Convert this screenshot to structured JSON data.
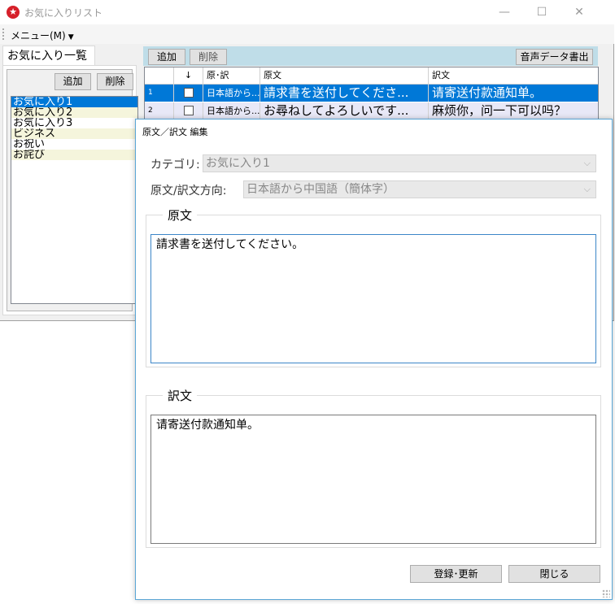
{
  "main_window": {
    "title": "お気に入りリスト",
    "icon": "favorite-star-icon",
    "controls": {
      "minimize": "—",
      "maximize": "☐",
      "close": "✕"
    }
  },
  "menubar": {
    "menu_label": "メニュー(M)"
  },
  "favorites_panel": {
    "tab_label": "お気に入り一覧",
    "add_button": "追加",
    "delete_button": "削除",
    "categories": [
      "お気に入り1",
      "お気に入り2",
      "お気に入り3",
      "ビジネス",
      "お祝い",
      "お詫び"
    ],
    "selected_index": 0
  },
  "phrase_toolbar": {
    "add_button": "追加",
    "delete_button": "削除",
    "export_audio_button": "音声データ書出"
  },
  "phrase_grid": {
    "headers": {
      "no": "",
      "check": "↓",
      "direction": "原･訳",
      "source": "原文",
      "translation": "訳文"
    },
    "rows": [
      {
        "no": "1",
        "direction": "日本語から...",
        "source": "請求書を送付してくださ...",
        "translation": "请寄送付款通知单。"
      },
      {
        "no": "2",
        "direction": "日本語から...",
        "source": "お尋ねしてよろしいです...",
        "translation": "麻烦你，问一下可以吗？"
      }
    ]
  },
  "edit_dialog": {
    "title": "原文／訳文 編集",
    "category_label": "カテゴリ:",
    "category_value": "お気に入り1",
    "direction_label": "原文/訳文方向:",
    "direction_value": "日本語から中国語（簡体字）",
    "source_group_label": "原文",
    "source_text": "請求書を送付してください。",
    "translation_group_label": "訳文",
    "translation_text": "请寄送付款通知单。",
    "register_button": "登録･更新",
    "close_button": "閉じる"
  },
  "colors": {
    "selection": "#0078d7",
    "toolbar_bg": "#bfdde8",
    "list_alt_row": "#f5f5dc",
    "dialog_border": "#5aa6d6"
  }
}
